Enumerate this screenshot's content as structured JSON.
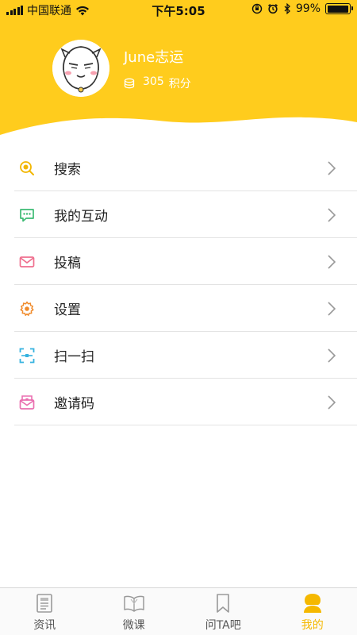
{
  "status_bar": {
    "carrier": "中国联通",
    "time": "下午5:05",
    "battery": "99%",
    "battery_level": 0.99
  },
  "profile": {
    "username": "June志运",
    "points_value": "305",
    "points_unit": "积分"
  },
  "menu": [
    {
      "label": "搜索",
      "icon": "search-icon",
      "color": "#f2b600"
    },
    {
      "label": "我的互动",
      "icon": "chat-icon",
      "color": "#3dbb74"
    },
    {
      "label": "投稿",
      "icon": "mail-icon",
      "color": "#ef6f8e"
    },
    {
      "label": "设置",
      "icon": "gear-icon",
      "color": "#f08a2a"
    },
    {
      "label": "扫一扫",
      "icon": "scan-icon",
      "color": "#36b3e0"
    },
    {
      "label": "邀请码",
      "icon": "invite-icon",
      "color": "#ea6fb0"
    }
  ],
  "tabbar": [
    {
      "label": "资讯",
      "icon": "news-icon",
      "active": false
    },
    {
      "label": "微课",
      "icon": "book-icon",
      "active": false
    },
    {
      "label": "问TA吧",
      "icon": "bookmark-icon",
      "active": false
    },
    {
      "label": "我的",
      "icon": "user-icon",
      "active": true
    }
  ],
  "colors": {
    "accent": "#ffcc1d",
    "active_tab": "#f5b800"
  }
}
